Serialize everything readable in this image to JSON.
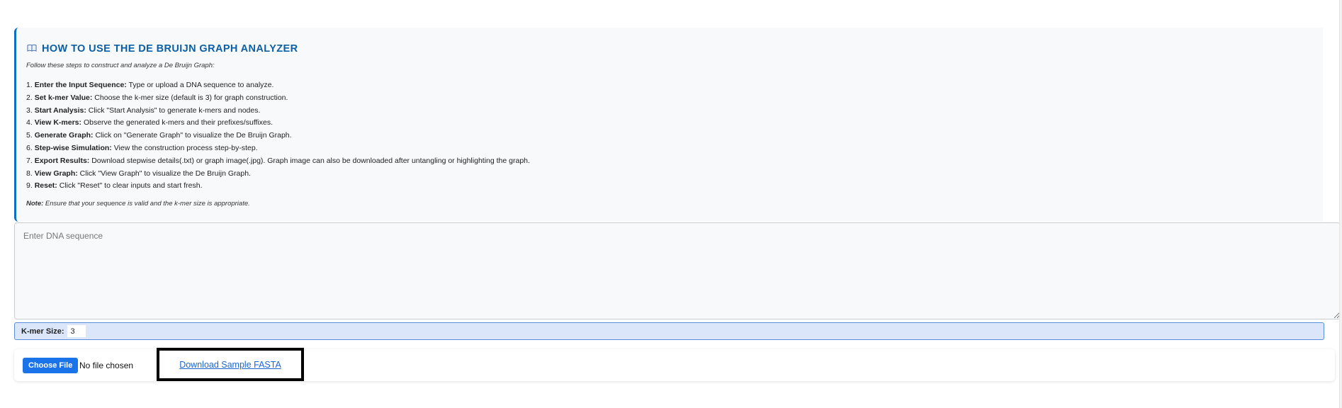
{
  "instructions": {
    "title": "HOW TO USE THE DE BRUIJN GRAPH ANALYZER",
    "icon": "open-book-icon",
    "intro": "Follow these steps to construct and analyze a De Bruijn Graph:",
    "steps": [
      {
        "num": "1. ",
        "label": "Enter the Input Sequence:",
        "text": " Type or upload a DNA sequence to analyze."
      },
      {
        "num": "2. ",
        "label": "Set k-mer Value:",
        "text": " Choose the k-mer size (default is 3) for graph construction."
      },
      {
        "num": "3. ",
        "label": "Start Analysis:",
        "text": " Click \"Start Analysis\" to generate k-mers and nodes."
      },
      {
        "num": "4. ",
        "label": "View K-mers:",
        "text": " Observe the generated k-mers and their prefixes/suffixes."
      },
      {
        "num": "5. ",
        "label": "Generate Graph:",
        "text": " Click on \"Generate Graph\" to visualize the De Bruijn Graph."
      },
      {
        "num": "6. ",
        "label": "Step-wise Simulation:",
        "text": " View the construction process step-by-step."
      },
      {
        "num": "7. ",
        "label": "Export Results:",
        "text": " Download stepwise details(.txt) or graph image(.jpg). Graph image can also be downloaded after untangling or highlighting the graph."
      },
      {
        "num": "8. ",
        "label": "View Graph:",
        "text": " Click \"View Graph\" to visualize the De Bruijn Graph."
      },
      {
        "num": "9. ",
        "label": "Reset:",
        "text": " Click \"Reset\" to clear inputs and start fresh."
      }
    ],
    "note_label": "Note:",
    "note_text": " Ensure that your sequence is valid and the k-mer size is appropriate."
  },
  "sequence_input": {
    "placeholder": "Enter DNA sequence",
    "value": ""
  },
  "kmer": {
    "label": "K-mer Size:",
    "value": "3"
  },
  "file": {
    "choose_label": "Choose File",
    "status": "No file chosen",
    "download_label": "Download Sample FASTA"
  },
  "colors": {
    "accent": "#0b6fc6",
    "title": "#0b5fa5",
    "button": "#1a73e8",
    "kmer_bg": "#dbe6fb",
    "link": "#1a66d0"
  }
}
